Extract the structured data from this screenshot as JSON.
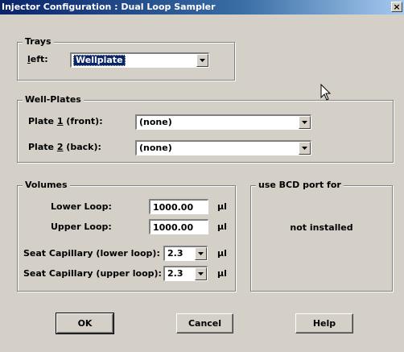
{
  "window": {
    "title": "Injector Configuration : Dual Loop Sampler",
    "close_glyph": "×"
  },
  "trays": {
    "legend": "Trays",
    "left_label_accel": "l",
    "left_label_rest": "eft:",
    "left_value": "Wellplate"
  },
  "well_plates": {
    "legend": "Well-Plates",
    "plate1_pre": "Plate ",
    "plate1_accel": "1",
    "plate1_post": " (front):",
    "plate1_value": "(none)",
    "plate2_pre": "Plate ",
    "plate2_accel": "2",
    "plate2_post": " (back):",
    "plate2_value": "(none)"
  },
  "volumes": {
    "legend": "Volumes",
    "lower_loop_label": "Lower Loop:",
    "lower_loop_value": "1000.00",
    "upper_loop_label": "Upper Loop:",
    "upper_loop_value": "1000.00",
    "unit": "µl",
    "seat_lower_label": "Seat Capillary (lower loop):",
    "seat_lower_value": "2.3",
    "seat_upper_label": "Seat Capillary (upper loop):",
    "seat_upper_value": "2.3"
  },
  "bcd": {
    "legend": "use BCD port for",
    "status": "not installed"
  },
  "buttons": {
    "ok": "OK",
    "cancel": "Cancel",
    "help": "Help"
  },
  "icons": {
    "dropdown": "chevron-down-icon",
    "cursor": "mouse-pointer-icon",
    "close": "close-icon"
  }
}
